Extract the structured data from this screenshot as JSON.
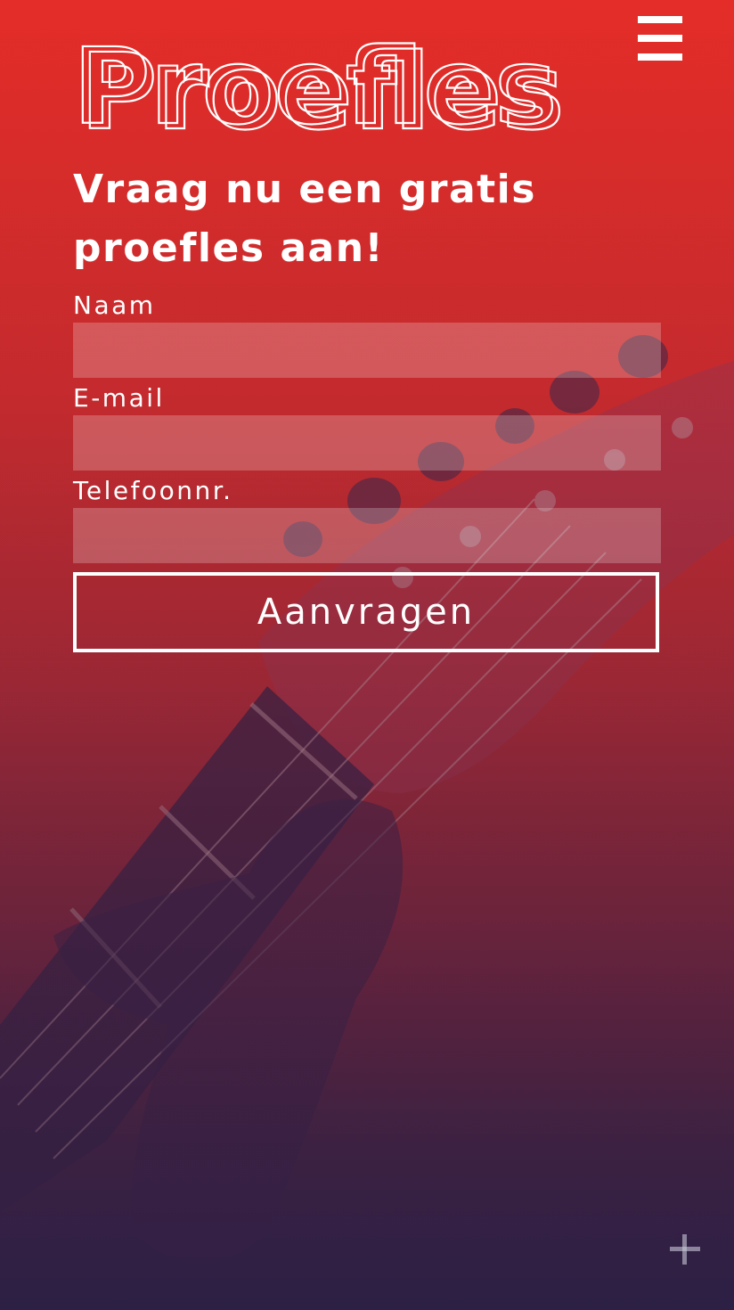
{
  "header": {
    "logo_text": "Proefles",
    "menu_icon": "hamburger-menu-icon"
  },
  "hero": {
    "heading_line1": "Vraag nu een gratis",
    "heading_line2": "proefles aan!"
  },
  "form": {
    "name_label": "Naam",
    "email_label": "E-mail",
    "phone_label": "Telefoonnr.",
    "name_value": "",
    "email_value": "",
    "phone_value": "",
    "submit_label": "Aanvragen"
  },
  "footer": {
    "plus_icon": "plus-icon"
  },
  "colors": {
    "background_top": "#e42d28",
    "background_bottom": "#2e2145",
    "text": "#ffffff"
  }
}
